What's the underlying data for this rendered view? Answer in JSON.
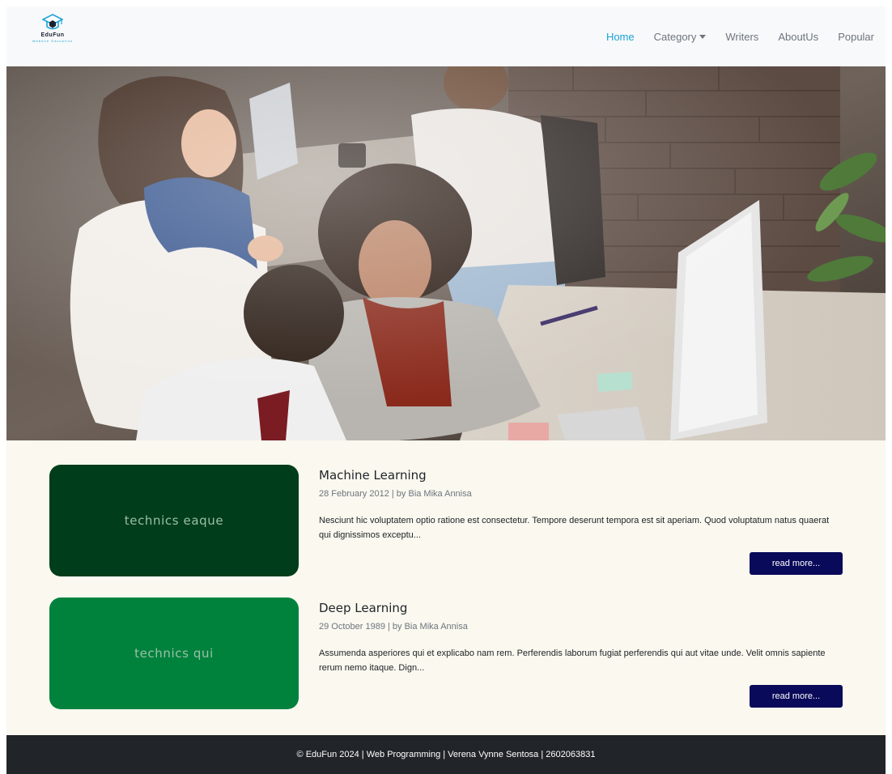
{
  "brand": {
    "name": "EduFun",
    "tagline": "Website Education"
  },
  "nav": {
    "items": [
      {
        "label": "Home",
        "active": true
      },
      {
        "label": "Category",
        "dropdown": true
      },
      {
        "label": "Writers"
      },
      {
        "label": "AboutUs"
      },
      {
        "label": "Popular"
      }
    ]
  },
  "hero": {
    "alt": "Group of people collaborating at desks with computers"
  },
  "articles": [
    {
      "thumbnail_text": "technics eaque",
      "thumbnail_color": "#003d1a",
      "title": "Machine Learning",
      "meta": "28 February 2012 | by Bia Mika Annisa",
      "excerpt": "Nesciunt hic voluptatem optio ratione est consectetur. Tempore deserunt tempora est sit aperiam. Quod voluptatum natus quaerat qui dignissimos exceptu...",
      "button_label": "read more..."
    },
    {
      "thumbnail_text": "technics qui",
      "thumbnail_color": "#00823d",
      "title": "Deep Learning",
      "meta": "29 October 1989 | by Bia Mika Annisa",
      "excerpt": "Assumenda asperiores qui et explicabo nam rem. Perferendis laborum fugiat perferendis qui aut vitae unde. Velit omnis sapiente rerum nemo itaque. Dign...",
      "button_label": "read more..."
    }
  ],
  "footer": {
    "text": "© EduFun 2024 | Web Programming | Verena Vynne Sentosa | 2602063831"
  },
  "colors": {
    "accent": "#1ba3d8",
    "button": "#0a0a5a",
    "footer_bg": "#212529",
    "content_bg": "#faf8ef"
  }
}
